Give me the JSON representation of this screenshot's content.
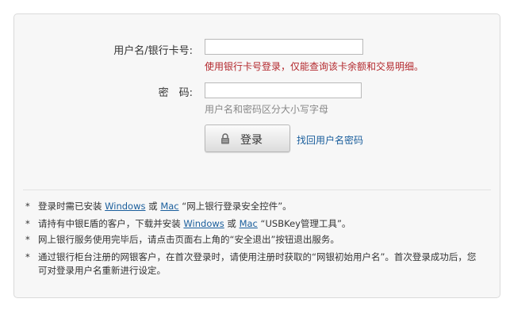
{
  "form": {
    "username_label": "用户名/银行卡号:",
    "username_value": "",
    "username_hint": "使用银行卡号登录，仅能查询该卡余额和交易明细。",
    "password_label": "密　码:",
    "password_value": "",
    "password_hint": "用户名和密码区分大小写字母",
    "login_button": "登录",
    "recover_link": "找回用户名密码"
  },
  "notes": {
    "bullet": "*",
    "n1": {
      "a": "登录时需已安装 ",
      "windows": "Windows",
      "or": " 或 ",
      "mac": "Mac",
      "b": " “网上银行登录安全控件”。"
    },
    "n2": {
      "a": "请持有中银E盾的客户，下载并安装 ",
      "windows": "Windows",
      "or": " 或 ",
      "mac": "Mac",
      "b": " “USBKey管理工具”。"
    },
    "n3": "网上银行服务使用完毕后，请点击页面右上角的“安全退出”按钮退出服务。",
    "n4": "通过银行柜台注册的网银客户，在首次登录时，请使用注册时获取的“网银初始用户名”。首次登录成功后，您可对登录用户名重新进行设定。"
  },
  "colors": {
    "link": "#1a5e9c",
    "error_hint": "#b3282d",
    "hint": "#888888",
    "panel_bg": "#f7f7f7"
  },
  "icons": {
    "login": "lock-icon"
  }
}
